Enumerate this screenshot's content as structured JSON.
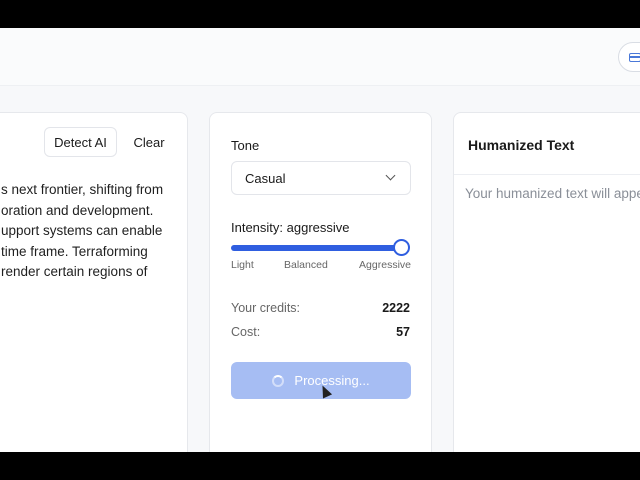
{
  "input_panel": {
    "detect_button": "Detect AI",
    "clear_button": "Clear",
    "text_lines": [
      "s next frontier, shifting from",
      "oration and development.",
      "upport systems can enable",
      " time frame. Terraforming",
      " render certain regions of"
    ]
  },
  "controls": {
    "tone_label": "Tone",
    "tone_value": "Casual",
    "intensity_label": "Intensity: aggressive",
    "intensity_level": 1.0,
    "intensity_ticks": [
      "Light",
      "Balanced",
      "Aggressive"
    ],
    "credits_label": "Your credits:",
    "credits_value": "2222",
    "cost_label": "Cost:",
    "cost_value": "57",
    "process_button": "Processing..."
  },
  "output_panel": {
    "title": "Humanized Text",
    "placeholder": "Your humanized text will appe"
  },
  "colors": {
    "accent": "#2f5ee0",
    "button_disabled": "#a6bdf3"
  },
  "icons": [
    "card-icon",
    "chevron-down-icon",
    "spinner-icon",
    "cursor-icon"
  ]
}
